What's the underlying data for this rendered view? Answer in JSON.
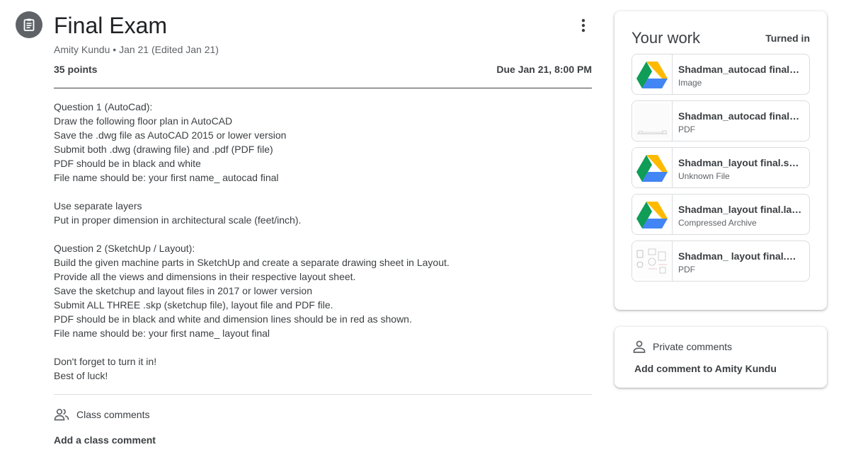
{
  "assignment": {
    "title": "Final Exam",
    "author": "Amity Kundu",
    "meta_separator": "•",
    "date": "Jan 21",
    "edited": "(Edited Jan 21)",
    "points": "35 points",
    "due": "Due Jan 21, 8:00 PM",
    "instructions": [
      "Question 1 (AutoCad):",
      "Draw the following floor plan in AutoCAD",
      "Save the .dwg file as AutoCAD 2015 or lower version",
      "Submit both .dwg (drawing file) and .pdf (PDF file)",
      "PDF should be in black and white",
      "File name should be: your first name_ autocad final",
      "",
      "Use separate layers",
      "Put in proper dimension in architectural scale (feet/inch).",
      "",
      "Question 2 (SketchUp / Layout):",
      "Build the given machine parts in SketchUp and create a separate drawing sheet in Layout.",
      "Provide all the views and dimensions in their respective layout sheet.",
      "Save the sketchup and layout files in 2017 or lower version",
      "Submit ALL THREE .skp (sketchup file), layout file and PDF file.",
      "PDF should be in black and white and dimension lines should be in red as shown.",
      "File name should be: your first name_ layout final",
      "",
      "Don't forget to turn it in!",
      "Best of luck!"
    ]
  },
  "class_comments": {
    "label": "Class comments",
    "add": "Add a class comment"
  },
  "your_work": {
    "title": "Your work",
    "status": "Turned in",
    "attachments": [
      {
        "name": "Shadman_autocad final…",
        "type": "Image",
        "thumb": "drive-icon"
      },
      {
        "name": "Shadman_autocad final…",
        "type": "PDF",
        "thumb": "floorplan-thumbnail"
      },
      {
        "name": "Shadman_layout final.s…",
        "type": "Unknown File",
        "thumb": "drive-icon"
      },
      {
        "name": "Shadman_layout final.la…",
        "type": "Compressed Archive",
        "thumb": "drive-icon"
      },
      {
        "name": "Shadman_ layout final.…",
        "type": "PDF",
        "thumb": "layout-thumbnail"
      }
    ]
  },
  "private_comments": {
    "label": "Private comments",
    "add": "Add comment to Amity Kundu"
  },
  "colors": {
    "icon_gray": "#5f6368",
    "text": "#3c4043",
    "border": "#dadce0",
    "drive_green": "#0F9D58",
    "drive_yellow": "#FFBA00",
    "drive_blue": "#4285F4"
  }
}
